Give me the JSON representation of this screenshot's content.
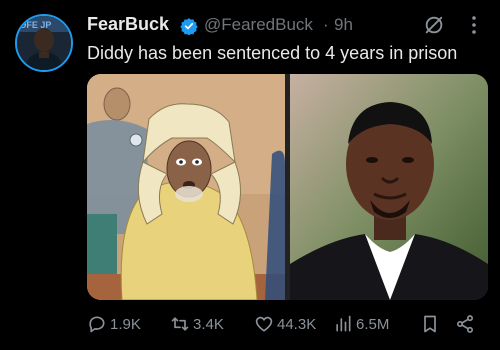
{
  "tweet": {
    "author_name": "FearBuck",
    "handle": "@FearedBuck",
    "separator": "·",
    "time": "9h",
    "text": "Diddy has been sentenced to 4 years in prison",
    "verified": true
  },
  "icons": {
    "verified": "verified-badge-icon",
    "grok": "grok-icon",
    "more": "more-vertical-icon",
    "reply": "reply-icon",
    "repost": "repost-icon",
    "like": "heart-icon",
    "views": "views-chart-icon",
    "bookmark": "bookmark-icon",
    "share": "share-icon"
  },
  "actions": {
    "replies": "1.9K",
    "reposts": "3.4K",
    "likes": "44.3K",
    "views": "6.5M"
  },
  "colors": {
    "background": "#000000",
    "text": "#e7e9ea",
    "muted": "#71767b",
    "verified_blue": "#1d9bf0"
  },
  "media": [
    {
      "name": "courtroom-sketch"
    },
    {
      "name": "portrait-photo"
    }
  ]
}
